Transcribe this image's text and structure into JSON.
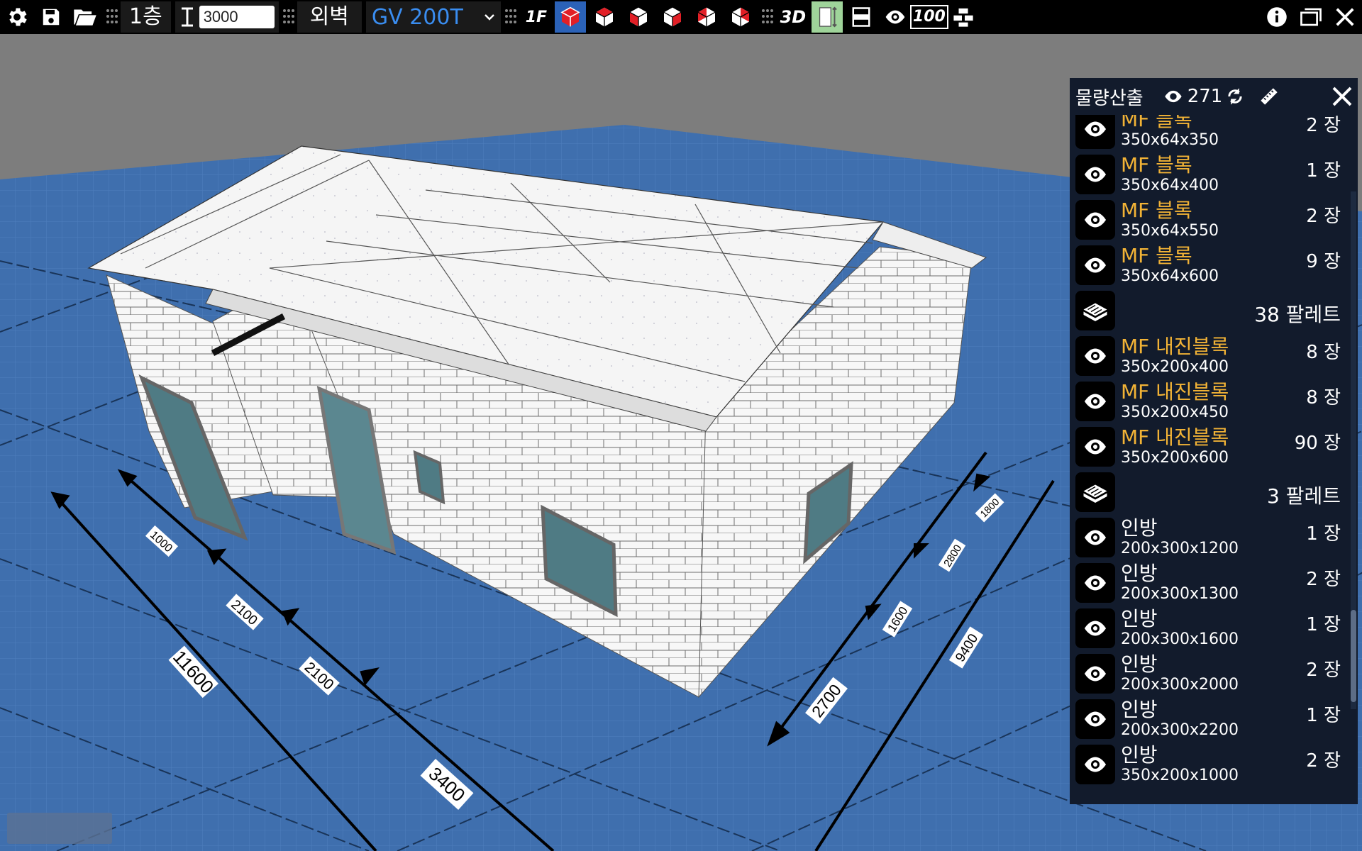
{
  "toolbar": {
    "floor_label": "1층",
    "height_value": "3000",
    "wall_label": "외벽",
    "material_value": "GV 200T",
    "floor_view_label": "1F",
    "view_3d_label": "3D",
    "scale_label": "100"
  },
  "scene": {
    "dimensions_left": [
      "11600",
      "1000",
      "2100",
      "2100",
      "3400"
    ],
    "dimensions_right": [
      "9400",
      "2700",
      "1600",
      "2800",
      "1800"
    ]
  },
  "panel": {
    "title": "물량산출",
    "count": "271",
    "items": [
      {
        "name": "MF 블록",
        "dim": "350x64x350",
        "qty": "2 장",
        "type": "item"
      },
      {
        "name": "MF 블록",
        "dim": "350x64x400",
        "qty": "1 장",
        "type": "item"
      },
      {
        "name": "MF 블록",
        "dim": "350x64x550",
        "qty": "2 장",
        "type": "item"
      },
      {
        "name": "MF 블록",
        "dim": "350x64x600",
        "qty": "9 장",
        "type": "item"
      },
      {
        "qty": "38 팔레트",
        "type": "pallet"
      },
      {
        "name": "MF 내진블록",
        "dim": "350x200x400",
        "qty": "8 장",
        "type": "item"
      },
      {
        "name": "MF 내진블록",
        "dim": "350x200x450",
        "qty": "8 장",
        "type": "item"
      },
      {
        "name": "MF 내진블록",
        "dim": "350x200x600",
        "qty": "90 장",
        "type": "item"
      },
      {
        "qty": "3 팔레트",
        "type": "pallet"
      },
      {
        "name": "인방",
        "dim": "200x300x1200",
        "qty": "1 장",
        "type": "lintel"
      },
      {
        "name": "인방",
        "dim": "200x300x1300",
        "qty": "2 장",
        "type": "lintel"
      },
      {
        "name": "인방",
        "dim": "200x300x1600",
        "qty": "1 장",
        "type": "lintel"
      },
      {
        "name": "인방",
        "dim": "200x300x2000",
        "qty": "2 장",
        "type": "lintel"
      },
      {
        "name": "인방",
        "dim": "200x300x2200",
        "qty": "1 장",
        "type": "lintel"
      },
      {
        "name": "인방",
        "dim": "350x200x1000",
        "qty": "2 장",
        "type": "lintel"
      }
    ]
  },
  "colors": {
    "toolbar_bg": "#000000",
    "panel_bg": "#121b2c",
    "item_name": "#f2b336",
    "ground": "#3f6fae",
    "sky": "#7d7d7d",
    "accent_blue": "#3a8df0"
  }
}
